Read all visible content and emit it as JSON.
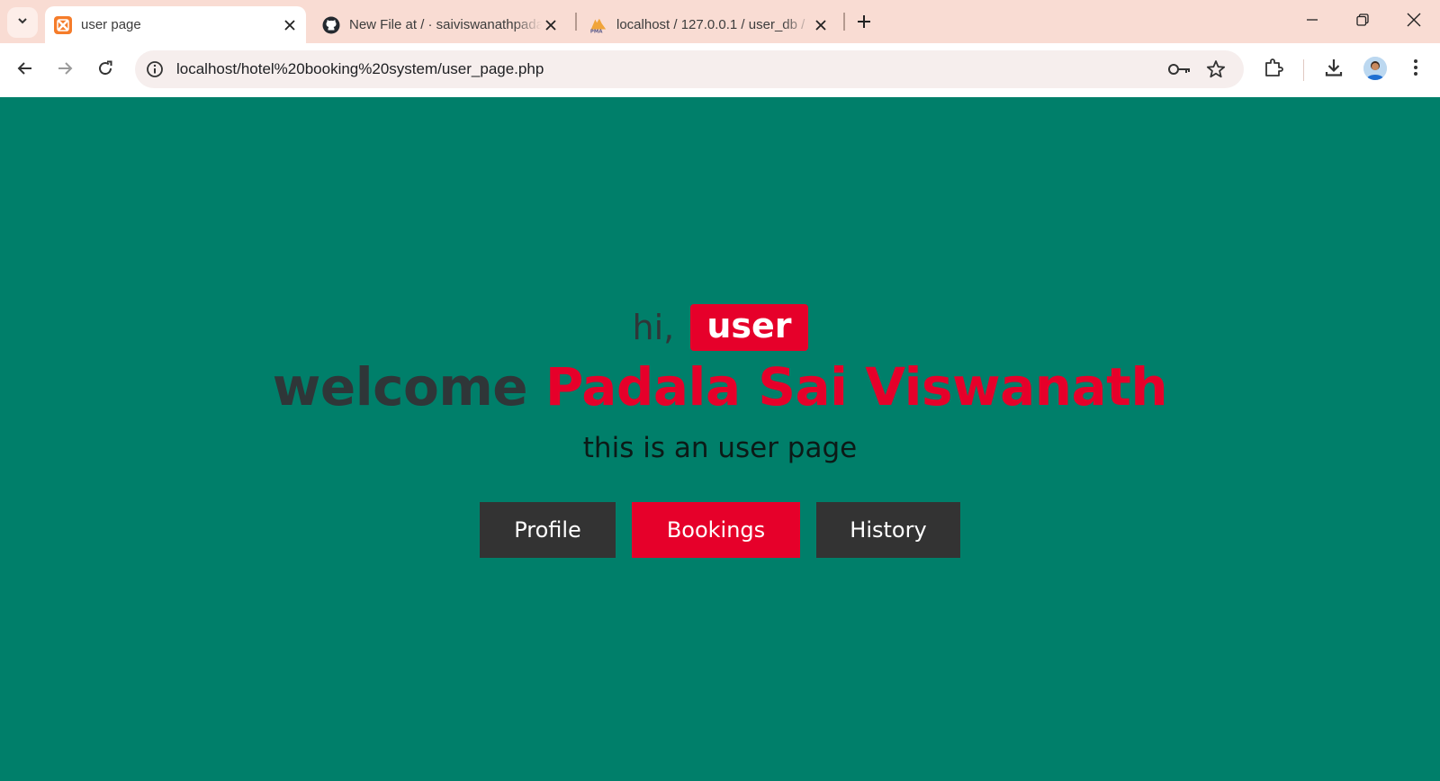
{
  "browser": {
    "tabs": [
      {
        "title": "user page",
        "active": true,
        "favicon": "xampp-icon"
      },
      {
        "title": "New File at / · saiviswanathpadala",
        "active": false,
        "favicon": "github-icon"
      },
      {
        "title": "localhost / 127.0.0.1 / user_db /",
        "active": false,
        "favicon": "phpmyadmin-icon"
      }
    ],
    "url": "localhost/hotel%20booking%20system/user_page.php",
    "colors": {
      "tabstrip": "#f9dcd3",
      "toolbar": "#ffffff",
      "omnibox": "#f6eeed"
    }
  },
  "page": {
    "greeting_prefix": "hi,",
    "user_role": "user",
    "welcome_prefix": "welcome",
    "user_name": "Padala Sai Viswanath",
    "subtitle": "this is an user page",
    "buttons": [
      {
        "label": "Profile",
        "style": "dark"
      },
      {
        "label": "Bookings",
        "style": "red"
      },
      {
        "label": "History",
        "style": "dark"
      }
    ],
    "colors": {
      "background": "#007f6a",
      "accent": "#e6002a",
      "dark": "#333333"
    }
  }
}
